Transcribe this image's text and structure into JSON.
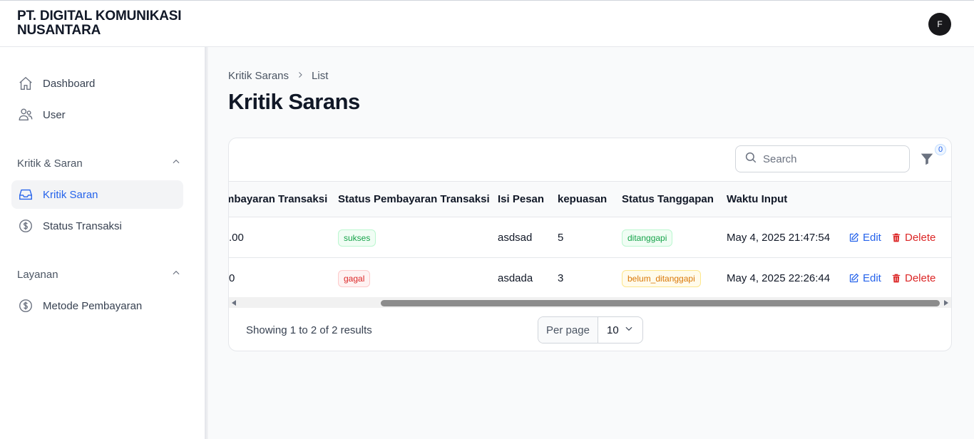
{
  "app": {
    "brand_line1": "PT. DIGITAL KOMUNIKASI",
    "brand_line2": "NUSANTARA",
    "avatar_initial": "F"
  },
  "sidebar": {
    "items": [
      {
        "label": "Dashboard",
        "icon": "home-icon"
      },
      {
        "label": "User",
        "icon": "users-icon"
      }
    ],
    "groups": [
      {
        "label": "Kritik & Saran",
        "items": [
          {
            "label": "Kritik Saran",
            "icon": "inbox-icon",
            "active": true
          },
          {
            "label": "Status Transaksi",
            "icon": "dollar-icon"
          }
        ]
      },
      {
        "label": "Layanan",
        "items": [
          {
            "label": "Metode Pembayaran",
            "icon": "dollar-icon"
          }
        ]
      }
    ]
  },
  "breadcrumb": {
    "parent": "Kritik Sarans",
    "current": "List"
  },
  "page_title": "Kritik Sarans",
  "search": {
    "placeholder": "Search"
  },
  "filter": {
    "count": "0"
  },
  "table": {
    "columns": [
      "mbayaran Transaksi",
      "Status Pembayaran Transaksi",
      "Isi Pesan",
      "kepuasan",
      "Status Tanggapan",
      "Waktu Input"
    ],
    "rows": [
      {
        "nominal": ".00",
        "status_pembayaran": "sukses",
        "isi_pesan": "asdsad",
        "kepuasan": "5",
        "status_tanggapan": "ditanggapi",
        "waktu_input": "May 4, 2025 21:47:54",
        "edit": "Edit",
        "delete": "Delete"
      },
      {
        "nominal": "0",
        "status_pembayaran": "gagal",
        "isi_pesan": "asdada",
        "kepuasan": "3",
        "status_tanggapan": "belum_ditanggapi",
        "waktu_input": "May 4, 2025 22:26:44",
        "edit": "Edit",
        "delete": "Delete"
      }
    ]
  },
  "pagination": {
    "summary": "Showing 1 to 2 of 2 results",
    "per_page_label": "Per page",
    "per_page_value": "10"
  }
}
